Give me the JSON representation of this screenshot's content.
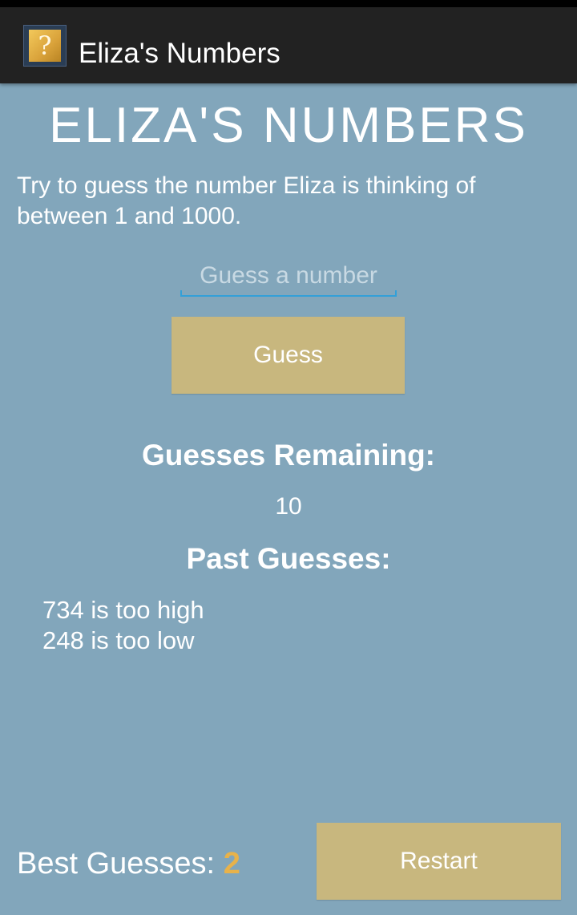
{
  "app": {
    "title": "Eliza's Numbers",
    "icon": "question-mark-icon",
    "icon_glyph": "?"
  },
  "game": {
    "heading": "ELIZA'S NUMBERS",
    "instructions": "Try to guess the number Eliza is thinking of between 1 and 1000.",
    "input": {
      "placeholder": "Guess a number",
      "value": ""
    },
    "guess_button_label": "Guess",
    "remaining_label": "Guesses Remaining:",
    "remaining_value": "10",
    "past_label": "Past Guesses:",
    "past_guesses": [
      "734 is too high",
      "248 is too low"
    ],
    "best_label": "Best Guesses:",
    "best_value": "2",
    "restart_button_label": "Restart"
  },
  "colors": {
    "background": "#82a6bb",
    "action_bar": "#222222",
    "button": "#c8b77e",
    "input_underline": "#33a0d8",
    "best_value": "#e8b24a"
  }
}
